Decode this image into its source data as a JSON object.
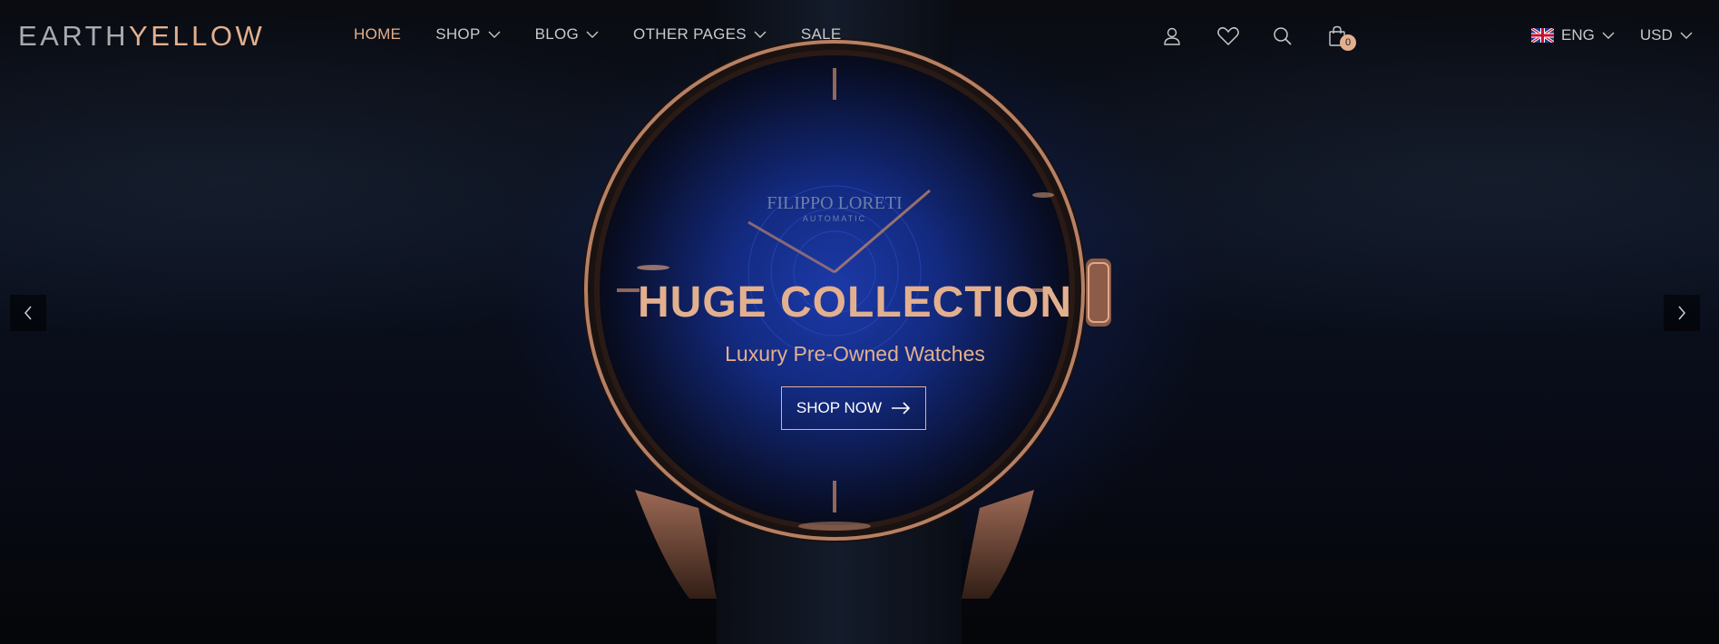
{
  "brand": {
    "part1": "EARTH",
    "part2": "YELLOW"
  },
  "nav": {
    "items": [
      {
        "label": "HOME",
        "active": true,
        "dropdown": false
      },
      {
        "label": "SHOP",
        "active": false,
        "dropdown": true
      },
      {
        "label": "BLOG",
        "active": false,
        "dropdown": true
      },
      {
        "label": "OTHER PAGES",
        "active": false,
        "dropdown": true
      },
      {
        "label": "SALE",
        "active": false,
        "dropdown": false
      }
    ]
  },
  "header_icons": {
    "account": "user-icon",
    "wishlist": "heart-icon",
    "search": "search-icon",
    "cart": "shopping-bag-icon",
    "cart_count": "0"
  },
  "locale": {
    "language": "ENG",
    "currency": "USD",
    "flag": "uk-flag-icon"
  },
  "hero": {
    "title": "HUGE COLLECTION",
    "subtitle": "Luxury Pre-Owned Watches",
    "cta_label": "SHOP NOW",
    "watch_brand": "FILIPPO LORETI",
    "watch_model": "AUTOMATIC"
  },
  "slider": {
    "prev_icon": "chevron-left-icon",
    "next_icon": "chevron-right-icon"
  },
  "colors": {
    "accent": "#e3b08f",
    "logo_grey": "#a9abb0",
    "background": "#07080b"
  }
}
